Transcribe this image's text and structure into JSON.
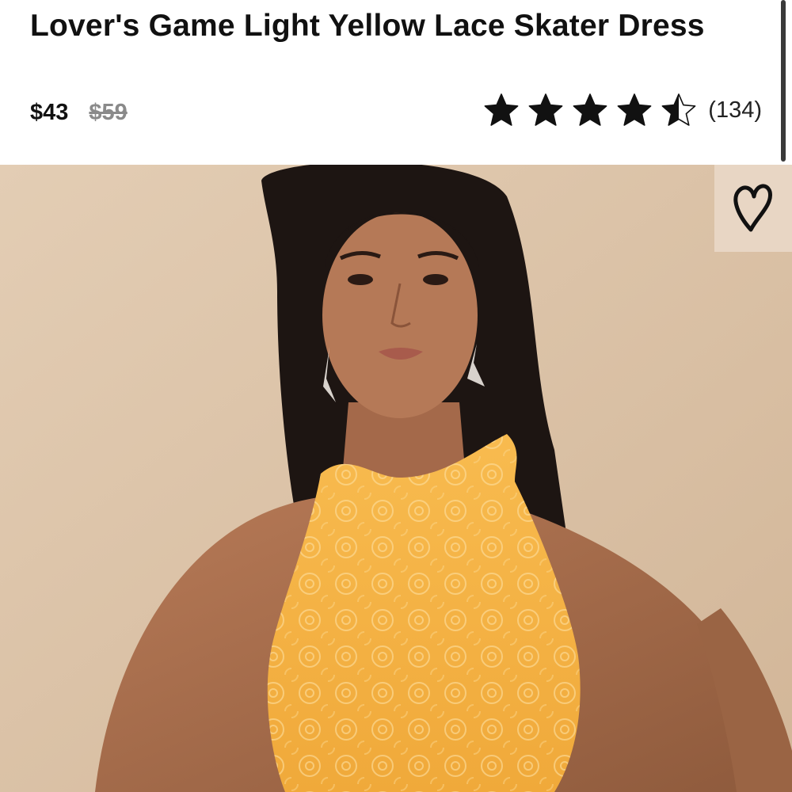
{
  "product": {
    "title": "Lover's Game Light Yellow Lace Skater Dress",
    "price": "$43",
    "original_price": "$59"
  },
  "rating": {
    "value": 4.5,
    "max": 5,
    "count_label": "(134)"
  },
  "image": {
    "alt_subject": "model-wearing-yellow-lace-halter-dress"
  },
  "favorite": {
    "icon": "heart-outline-icon"
  },
  "colors": {
    "background": "#ffffff",
    "text": "#111111",
    "strike_price": "#8a8a8a",
    "dress": "#f6b445",
    "backdrop": "#dfc7ad"
  }
}
